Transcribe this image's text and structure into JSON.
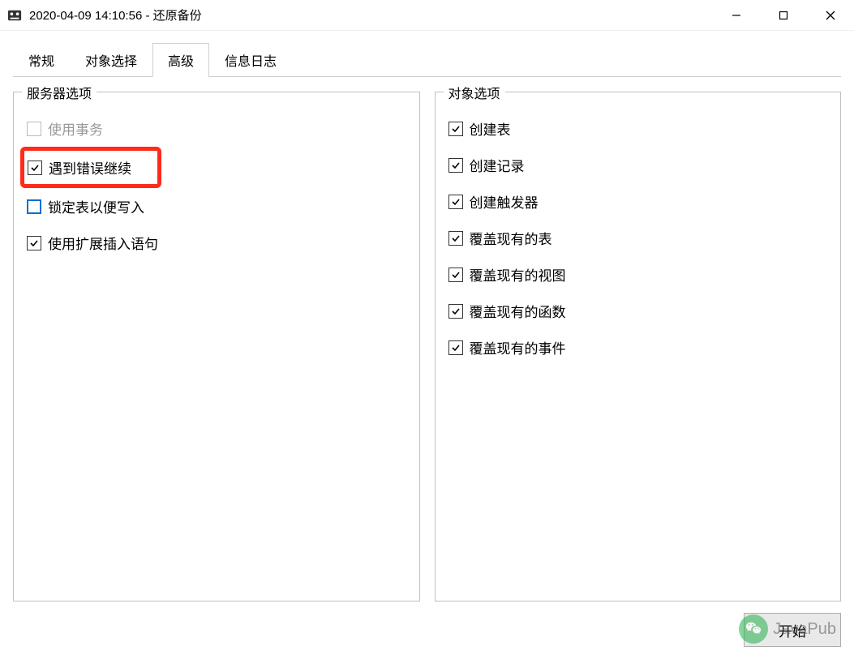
{
  "titlebar": {
    "title": "2020-04-09 14:10:56 - 还原备份"
  },
  "tabs": [
    {
      "label": "常规",
      "active": false
    },
    {
      "label": "对象选择",
      "active": false
    },
    {
      "label": "高级",
      "active": true
    },
    {
      "label": "信息日志",
      "active": false
    }
  ],
  "server_options": {
    "title": "服务器选项",
    "items": [
      {
        "label": "使用事务",
        "checked": false,
        "disabled": true,
        "highlight": false
      },
      {
        "label": "遇到错误继续",
        "checked": true,
        "disabled": false,
        "highlight": true
      },
      {
        "label": "锁定表以便写入",
        "checked": false,
        "disabled": false,
        "highlight": false,
        "blue": true
      },
      {
        "label": "使用扩展插入语句",
        "checked": true,
        "disabled": false,
        "highlight": false
      }
    ]
  },
  "object_options": {
    "title": "对象选项",
    "items": [
      {
        "label": "创建表",
        "checked": true
      },
      {
        "label": "创建记录",
        "checked": true
      },
      {
        "label": "创建触发器",
        "checked": true
      },
      {
        "label": "覆盖现有的表",
        "checked": true
      },
      {
        "label": "覆盖现有的视图",
        "checked": true
      },
      {
        "label": "覆盖现有的函数",
        "checked": true
      },
      {
        "label": "覆盖现有的事件",
        "checked": true
      }
    ]
  },
  "footer": {
    "start_label": "开始"
  },
  "watermark": {
    "text": "JavaPub"
  }
}
